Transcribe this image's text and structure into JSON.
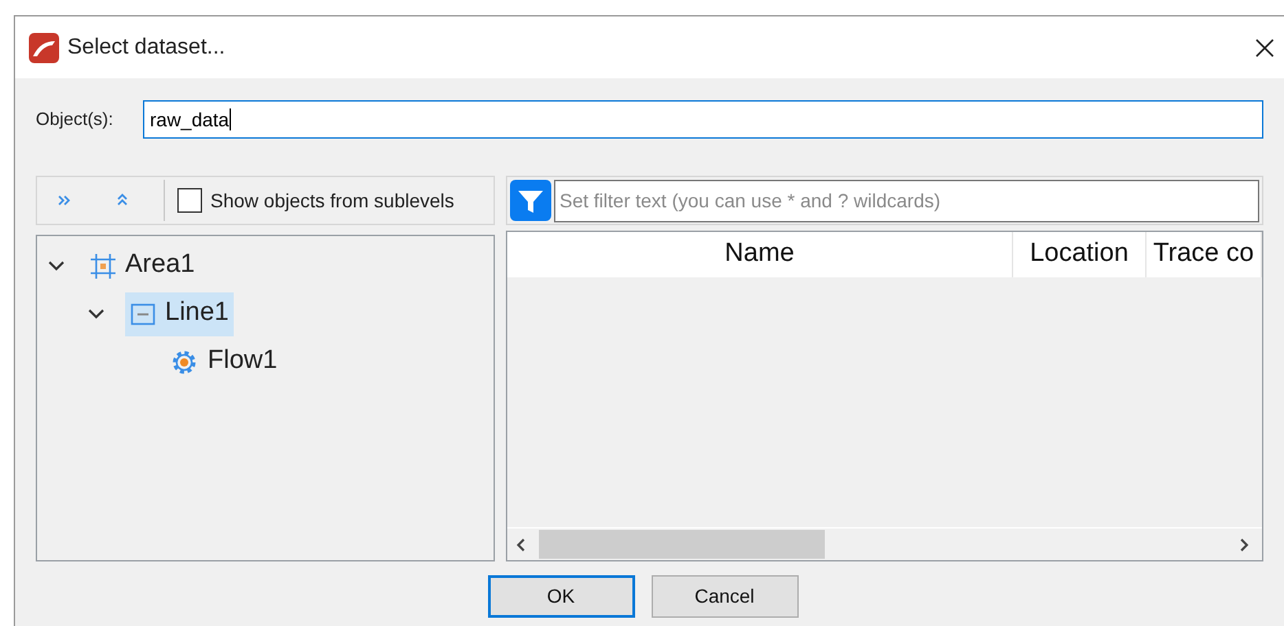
{
  "window": {
    "title": "Select dataset..."
  },
  "objects_field": {
    "label": "Object(s):",
    "value": "raw_data"
  },
  "toolbar": {
    "show_sublevels": {
      "label": "Show objects from sublevels",
      "checked": false
    }
  },
  "tree": [
    {
      "label": "Area1",
      "kind": "area",
      "expanded": true,
      "selected": false,
      "children": [
        {
          "label": "Line1",
          "kind": "line",
          "expanded": true,
          "selected": true,
          "children": [
            {
              "label": "Flow1",
              "kind": "flow",
              "selected": false
            }
          ]
        }
      ]
    }
  ],
  "filter": {
    "placeholder": "Set filter text (you can use * and ? wildcards)"
  },
  "table": {
    "columns": [
      "Name",
      "Location",
      "Trace co"
    ]
  },
  "buttons": [
    {
      "label": "OK",
      "default": true
    },
    {
      "label": "Cancel",
      "default": false
    }
  ]
}
